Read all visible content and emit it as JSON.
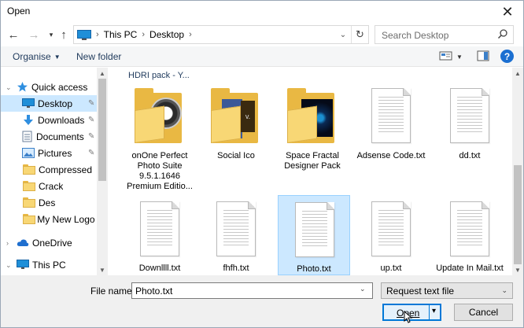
{
  "window": {
    "title": "Open"
  },
  "address": {
    "segments": [
      "This PC",
      "Desktop"
    ]
  },
  "search": {
    "placeholder": "Search Desktop"
  },
  "toolbar": {
    "organise": "Organise",
    "new_folder": "New folder"
  },
  "navpane": {
    "items": [
      {
        "label": "Quick access",
        "icon": "star-icon"
      },
      {
        "label": "Desktop",
        "icon": "desktop-icon",
        "pinned": true,
        "selected": true
      },
      {
        "label": "Downloads",
        "icon": "download-icon",
        "pinned": true
      },
      {
        "label": "Documents",
        "icon": "documents-icon",
        "pinned": true
      },
      {
        "label": "Pictures",
        "icon": "pictures-icon",
        "pinned": true
      },
      {
        "label": "Compressed",
        "icon": "folder-icon"
      },
      {
        "label": "Crack",
        "icon": "folder-icon"
      },
      {
        "label": "Des",
        "icon": "folder-icon"
      },
      {
        "label": "My New Logo D",
        "icon": "folder-icon"
      },
      {
        "label": "OneDrive",
        "icon": "cloud-icon"
      },
      {
        "label": "This PC",
        "icon": "computer-icon"
      }
    ]
  },
  "files": {
    "group_header": "HDRI pack - Y...",
    "items": [
      {
        "name": "onOne Perfect Photo Suite 9.5.1.1646 Premium Editio...",
        "type": "folder"
      },
      {
        "name": "Social Ico",
        "type": "folder"
      },
      {
        "name": "Space Fractal Designer Pack",
        "type": "folder"
      },
      {
        "name": "Adsense Code.txt",
        "type": "text"
      },
      {
        "name": "dd.txt",
        "type": "text"
      },
      {
        "name": "Downllll.txt",
        "type": "text"
      },
      {
        "name": "fhfh.txt",
        "type": "text"
      },
      {
        "name": "Photo.txt",
        "type": "text",
        "selected": true
      },
      {
        "name": "up.txt",
        "type": "text"
      },
      {
        "name": "Update In Mail.txt",
        "type": "text"
      }
    ]
  },
  "bottom": {
    "file_name_label": "File name:",
    "file_name_value": "Photo.txt",
    "file_type": "Request text file",
    "open_label": "Open",
    "cancel_label": "Cancel"
  },
  "colors": {
    "accent": "#0078d7",
    "selection": "#cce8ff",
    "folder": "#f8d775"
  }
}
